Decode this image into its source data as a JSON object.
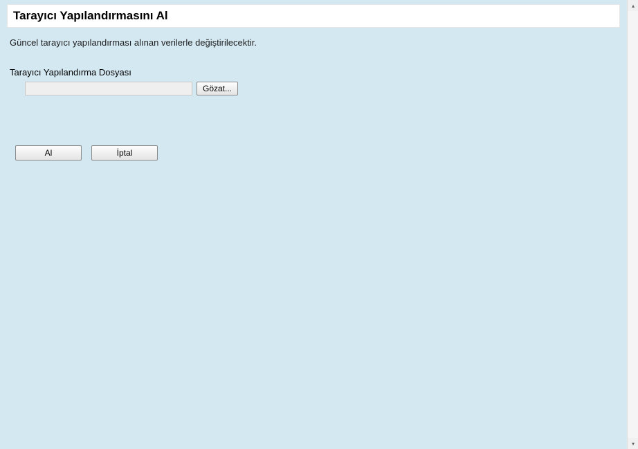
{
  "title": "Tarayıcı Yapılandırmasını Al",
  "description": "Güncel tarayıcı yapılandırması alınan verilerle değiştirilecektir.",
  "fileLabel": "Tarayıcı Yapılandırma Dosyası",
  "fileInputValue": "",
  "browseLabel": "Gözat...",
  "buttons": {
    "import": "Al",
    "cancel": "İptal"
  }
}
